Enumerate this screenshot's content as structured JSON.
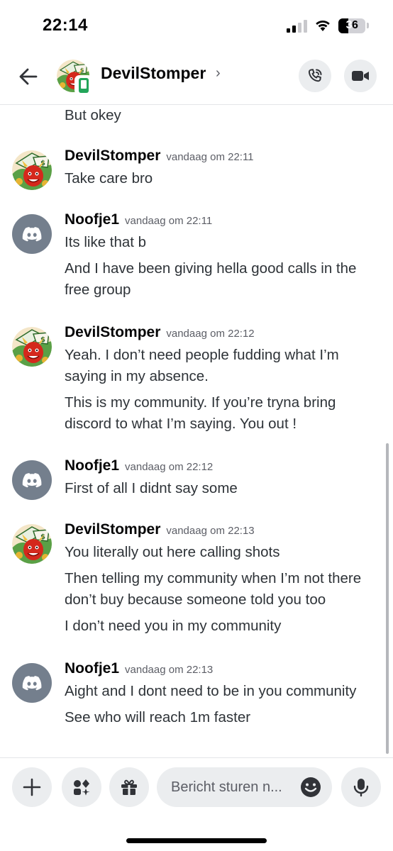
{
  "status_bar": {
    "time": "22:14",
    "battery": "36"
  },
  "header": {
    "channel_name": "DevilStomper",
    "chevron": "›",
    "icons": [
      "back-arrow-icon",
      "mobile-icon",
      "phone-call-icon",
      "video-camera-icon"
    ]
  },
  "messages": {
    "top_continuation": "But okey",
    "groups": [
      {
        "author": "DevilStomper",
        "timestamp": "vandaag om 22:11",
        "lines": [
          "Take care bro"
        ]
      },
      {
        "author": "Noofje1",
        "timestamp": "vandaag om 22:11",
        "lines": [
          "Its like that b",
          "And I have been giving hella good calls in the free group"
        ]
      },
      {
        "author": "DevilStomper",
        "timestamp": "vandaag om 22:12",
        "lines": [
          "Yeah. I don’t need people fudding what I’m saying in my absence.",
          "This is my community. If you’re tryna bring discord to what I’m saying. You out !"
        ]
      },
      {
        "author": "Noofje1",
        "timestamp": "vandaag om 22:12",
        "lines": [
          "First of all I didnt say some"
        ]
      },
      {
        "author": "DevilStomper",
        "timestamp": "vandaag om 22:13",
        "lines": [
          "You literally out here calling shots",
          "Then telling my community when I’m not there don’t buy because someone told you too",
          "I don’t need you in my community"
        ]
      },
      {
        "author": "Noofje1",
        "timestamp": "vandaag om 22:13",
        "lines": [
          "Aight and I dont need to be in you community",
          "See who will reach 1m faster"
        ]
      }
    ]
  },
  "composer": {
    "placeholder": "Bericht sturen n...",
    "icons": [
      "plus-icon",
      "apps-icon",
      "gift-icon",
      "emoji-icon",
      "microphone-icon"
    ]
  },
  "colors": {
    "button_bg": "#ebedef",
    "discord_avatar": "#747f8d",
    "online_mobile": "#23a55a",
    "text": "#2e3338",
    "muted": "#5c5e66"
  }
}
